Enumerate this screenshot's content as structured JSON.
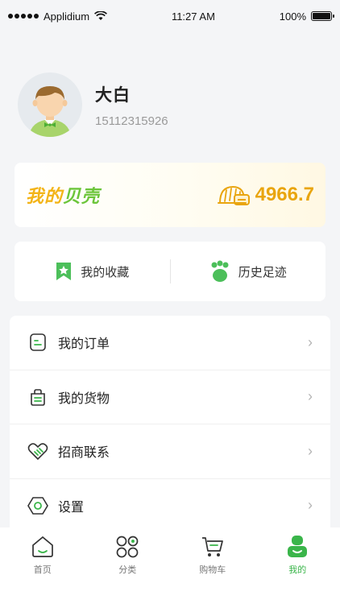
{
  "status_bar": {
    "carrier": "Applidium",
    "time": "11:27 AM",
    "battery": "100%",
    "battery_level": 1.0
  },
  "profile": {
    "name": "大白",
    "phone": "15112315926"
  },
  "shell": {
    "title_part1": "我的",
    "title_part2": "贝壳",
    "value": "4966.7"
  },
  "shortcuts": {
    "favorites": "我的收藏",
    "history": "历史足迹"
  },
  "menu": [
    {
      "label": "我的订单",
      "icon": "order-icon"
    },
    {
      "label": "我的货物",
      "icon": "goods-icon"
    },
    {
      "label": "招商联系",
      "icon": "handshake-icon"
    },
    {
      "label": "设置",
      "icon": "settings-icon"
    }
  ],
  "tabs": [
    {
      "label": "首页",
      "icon": "home-icon"
    },
    {
      "label": "分类",
      "icon": "category-icon"
    },
    {
      "label": "购物车",
      "icon": "cart-icon"
    },
    {
      "label": "我的",
      "icon": "profile-icon",
      "active": true
    }
  ],
  "colors": {
    "accent_green": "#3ab54a",
    "gold": "#e9a50f"
  }
}
